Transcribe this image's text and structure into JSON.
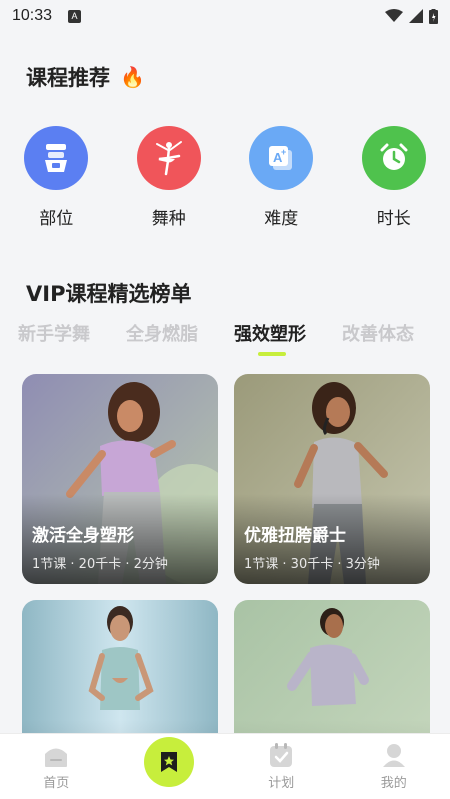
{
  "status": {
    "time": "10:33",
    "notif_letter": "A"
  },
  "recommend": {
    "title": "课程推荐",
    "emoji": "🔥"
  },
  "categories": [
    {
      "label": "部位",
      "color": "#5b7ff2",
      "icon": "body-part-icon"
    },
    {
      "label": "舞种",
      "color": "#f0555a",
      "icon": "ballet-dancer-icon"
    },
    {
      "label": "难度",
      "color": "#6aa9f5",
      "icon": "difficulty-icon"
    },
    {
      "label": "时长",
      "color": "#4fc24d",
      "icon": "clock-icon"
    }
  ],
  "vip": {
    "title": "VIP课程精选榜单"
  },
  "tabs": [
    {
      "label": "新手学舞",
      "active": false
    },
    {
      "label": "全身燃脂",
      "active": false
    },
    {
      "label": "强效塑形",
      "active": true
    },
    {
      "label": "改善体态",
      "active": false
    }
  ],
  "cards": [
    {
      "title": "激活全身塑形",
      "meta": "1节课 · 20千卡 · 2分钟"
    },
    {
      "title": "优雅扭胯爵士",
      "meta": "1节课 · 30千卡 · 3分钟"
    },
    {
      "title": "",
      "meta": ""
    },
    {
      "title": "",
      "meta": ""
    }
  ],
  "nav": [
    {
      "label": "首页",
      "icon": "home-icon"
    },
    {
      "label": "",
      "icon": "course-bookmark-icon"
    },
    {
      "label": "计划",
      "icon": "plan-calendar-icon"
    },
    {
      "label": "我的",
      "icon": "profile-icon"
    }
  ],
  "colors": {
    "accent": "#c7ee3c",
    "background": "#f4f5f7"
  }
}
